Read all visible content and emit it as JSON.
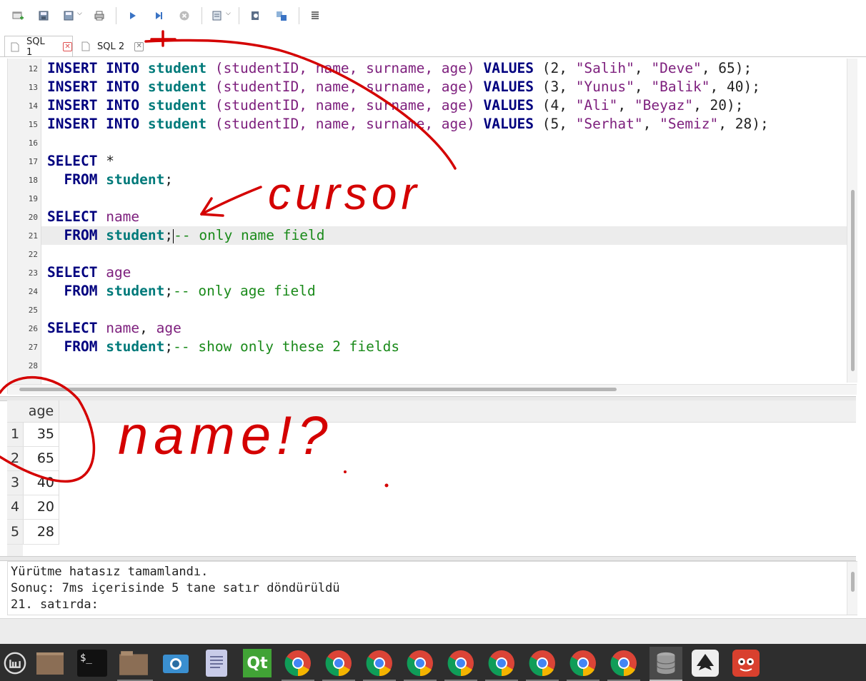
{
  "toolbar": {
    "icons": [
      "new-tab-icon",
      "open-file-icon",
      "save-file-icon",
      "print-icon",
      "execute-all-icon",
      "execute-line-icon",
      "stop-icon",
      "save-results-icon",
      "find-icon",
      "find-replace-icon",
      "format-icon"
    ]
  },
  "tabs": [
    {
      "label": "SQL 1",
      "active": true
    },
    {
      "label": "SQL 2",
      "active": false
    }
  ],
  "editor": {
    "line_numbers": [
      "12",
      "13",
      "14",
      "15",
      "16",
      "17",
      "18",
      "19",
      "20",
      "21",
      "22",
      "23",
      "24",
      "25",
      "26",
      "27",
      "28"
    ],
    "insert_rows": [
      {
        "kw1": "INSERT INTO",
        "table": "student",
        "cols": "(studentID, name, surname, age)",
        "kw2": "VALUES",
        "open": " (2, ",
        "s1": "\"Salih\"",
        "sep": ", ",
        "s2": "\"Deve\"",
        "tail": ", 65);"
      },
      {
        "kw1": "INSERT INTO",
        "table": "student",
        "cols": "(studentID, name, surname, age)",
        "kw2": "VALUES",
        "open": " (3, ",
        "s1": "\"Yunus\"",
        "sep": ", ",
        "s2": "\"Balik\"",
        "tail": ", 40);"
      },
      {
        "kw1": "INSERT INTO",
        "table": "student",
        "cols": "(studentID, name, surname, age)",
        "kw2": "VALUES",
        "open": " (4, ",
        "s1": "\"Ali\"",
        "sep": ", ",
        "s2": "\"Beyaz\"",
        "tail": ", 20);"
      },
      {
        "kw1": "INSERT INTO",
        "table": "student",
        "cols": "(studentID, name, surname, age)",
        "kw2": "VALUES",
        "open": " (5, ",
        "s1": "\"Serhat\"",
        "sep": ", ",
        "s2": "\"Semiz\"",
        "tail": ", 28);"
      }
    ],
    "select": "SELECT",
    "from": "FROM",
    "table": "student",
    "semi": ";",
    "star": "*",
    "q2_col": "name",
    "q2_comment": "-- only name field",
    "q3_col": "age",
    "q3_comment": "-- only age field",
    "q4_col1": "name",
    "q4_sep": ", ",
    "q4_col2": "age",
    "q4_comment": "-- show only these 2 fields"
  },
  "results": {
    "column": "age",
    "row_numbers": [
      "1",
      "2",
      "3",
      "4",
      "5"
    ],
    "values": [
      "35",
      "65",
      "40",
      "20",
      "28"
    ]
  },
  "messages": [
    "Yürütme hatasız tamamlandı.",
    "Sonuç: 7ms içerisinde 5 tane satır döndürüldü",
    "21. satırda:"
  ],
  "annotations": {
    "cursor_text": "cursor",
    "name_text": "name!?",
    "ink_color": "#d40000"
  },
  "taskbar": {
    "items": [
      "menu-icon",
      "folder-icon",
      "terminal-icon",
      "files-icon",
      "screenshot-icon",
      "text-editor-icon",
      "qt-creator-icon",
      "chrome-icon",
      "chrome-icon",
      "chrome-icon",
      "chrome-icon",
      "chrome-icon",
      "chrome-icon",
      "chrome-icon",
      "chrome-icon",
      "chrome-icon",
      "sqlite-browser-icon",
      "inkscape-icon",
      "gimp-icon"
    ],
    "terminal_label": "$_",
    "qt_label": "Qt"
  }
}
